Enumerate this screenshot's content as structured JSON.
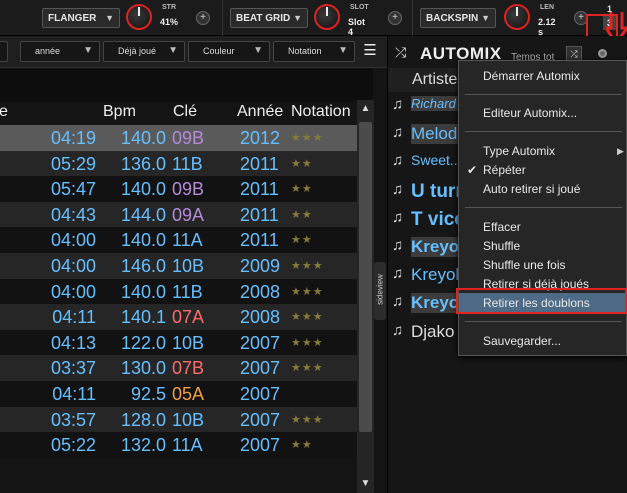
{
  "fx": [
    {
      "name": "FLANGER",
      "knob_label": "STR",
      "knob_value": "41%"
    },
    {
      "name": "BEAT GRID",
      "knob_label": "SLOT",
      "knob_value": "Slot 4"
    },
    {
      "name": "BACKSPIN",
      "knob_label": "LEN",
      "knob_value": "2.12 s"
    }
  ],
  "fx_plus": "+",
  "slots": [
    "1",
    "3"
  ],
  "filters": {
    "f1": "année",
    "f2": "Déjà joué",
    "f3": "Couleur",
    "f4": "Notation"
  },
  "list_view_icon": "☰",
  "columns": {
    "first": "e",
    "bpm": "Bpm",
    "key": "Clé",
    "year": "Année",
    "rating": "Notation"
  },
  "rows": [
    {
      "time": "04:19",
      "bpm": "140.0",
      "key": "09B",
      "year": "2012",
      "rating": "★★★",
      "key_color": "#b58ad8"
    },
    {
      "time": "05:29",
      "bpm": "136.0",
      "key": "11B",
      "year": "2011",
      "rating": "★★",
      "key_color": "#66bfff"
    },
    {
      "time": "05:47",
      "bpm": "140.0",
      "key": "09B",
      "year": "2011",
      "rating": "★★",
      "key_color": "#b58ad8"
    },
    {
      "time": "04:43",
      "bpm": "144.0",
      "key": "09A",
      "year": "2011",
      "rating": "★★",
      "key_color": "#b58ad8"
    },
    {
      "time": "04:00",
      "bpm": "140.0",
      "key": "11A",
      "year": "2011",
      "rating": "★★",
      "key_color": "#66bfff"
    },
    {
      "time": "04:00",
      "bpm": "146.0",
      "key": "10B",
      "year": "2009",
      "rating": "★★★",
      "key_color": "#66bfff"
    },
    {
      "time": "04:00",
      "bpm": "140.0",
      "key": "11B",
      "year": "2008",
      "rating": "★★★",
      "key_color": "#66bfff"
    },
    {
      "time": "04:11",
      "bpm": "140.1",
      "key": "07A",
      "year": "2008",
      "rating": "★★★",
      "key_color": "#ff6b6b"
    },
    {
      "time": "04:13",
      "bpm": "122.0",
      "key": "10B",
      "year": "2007",
      "rating": "★★★",
      "key_color": "#66bfff"
    },
    {
      "time": "03:37",
      "bpm": "130.0",
      "key": "07B",
      "year": "2007",
      "rating": "★★★",
      "key_color": "#ff6b6b"
    },
    {
      "time": "04:11",
      "bpm": "92.5",
      "key": "05A",
      "year": "2007",
      "rating": "",
      "key_color": "#f0a040"
    },
    {
      "time": "03:57",
      "bpm": "128.0",
      "key": "10B",
      "year": "2007",
      "rating": "★★★",
      "key_color": "#66bfff"
    },
    {
      "time": "05:22",
      "bpm": "132.0",
      "key": "11A",
      "year": "2007",
      "rating": "★★",
      "key_color": "#66bfff"
    }
  ],
  "scroll": {
    "up": "▲",
    "down": "▼"
  },
  "sideview": "sideview",
  "automix": {
    "title": "AUTOMIX",
    "time_label": "Temps tot",
    "column": "Artiste",
    "tracks": [
      {
        "title": "Richard ca",
        "color": "#66bfff",
        "highlight": true
      },
      {
        "title": "Melodee",
        "color": "#66bfff",
        "highlight": true
      },
      {
        "title": "Sweet...",
        "color": "#66bfff",
        "highlight": false
      },
      {
        "title": "U turn",
        "color": "#66bfff",
        "highlight": false
      },
      {
        "title": "T vice",
        "color": "#66bfff",
        "highlight": false
      },
      {
        "title": "Kreyol",
        "color": "#66bfff",
        "highlight": true
      },
      {
        "title": "Kreyol",
        "color": "#66bfff",
        "highlight": false
      },
      {
        "title": "Kreyol",
        "color": "#66bfff",
        "highlight": true
      },
      {
        "title": "Djako",
        "color": "#dddddd",
        "highlight": false
      }
    ]
  },
  "menu": {
    "start": "Démarrer Automix",
    "editor": "Editeur Automix...",
    "type": "Type Automix",
    "repeat": "Répéter",
    "auto_remove": "Auto retirer si joué",
    "clear": "Effacer",
    "shuffle": "Shuffle",
    "shuffle_once": "Shuffle une fois",
    "remove_played": "Retirer si déjà joués",
    "remove_dupes": "Retirer les doublons",
    "save": "Sauvegarder...",
    "check": "✔",
    "arrow": "▶"
  },
  "colors": {
    "accent_red": "#e02424",
    "menu_highlight": "#4d6a86"
  }
}
